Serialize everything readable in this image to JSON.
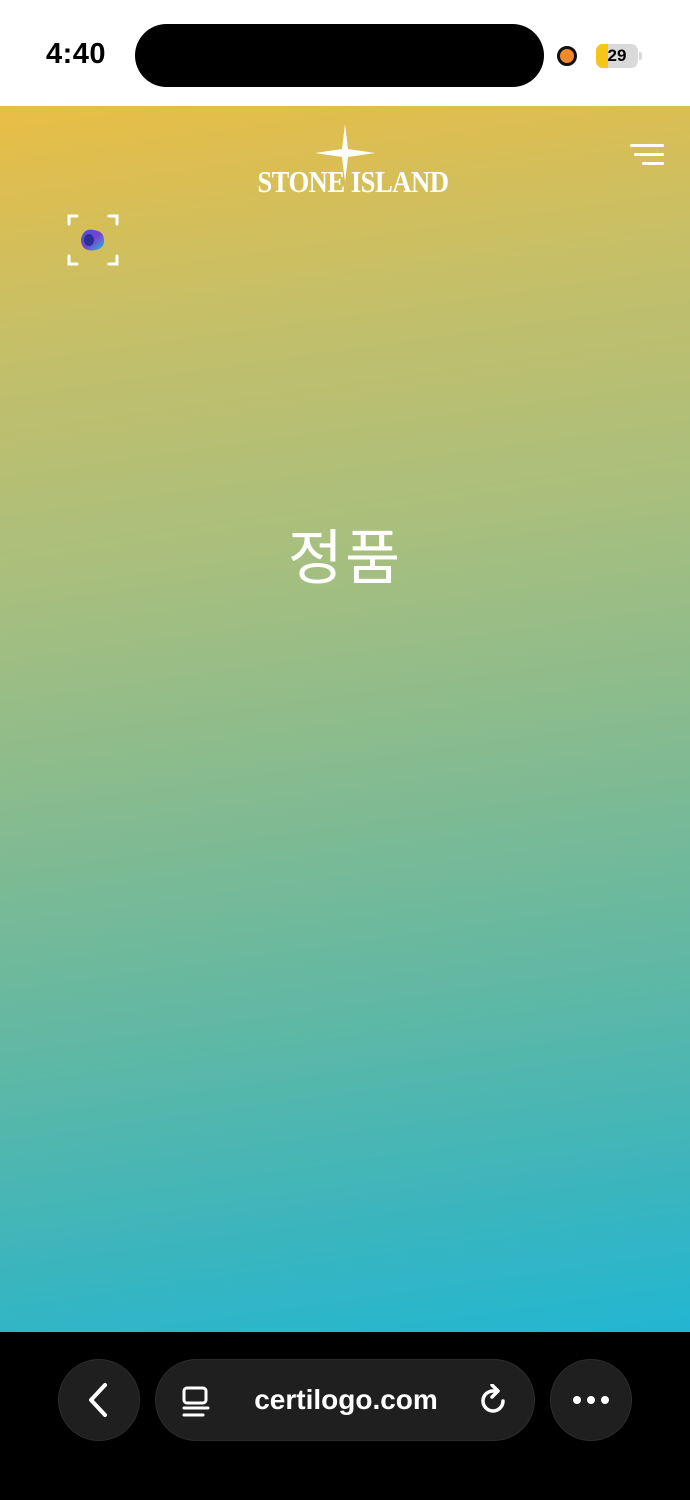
{
  "status_bar": {
    "time": "4:40",
    "battery_level": "29",
    "battery_fraction": 0.29,
    "recording_indicator_color": "#f08a2a",
    "battery_color": "#f5c51a"
  },
  "header": {
    "brand_name": "STONE ISLAND",
    "logo_icon": "compass-star-icon",
    "menu_icon": "menu-icon"
  },
  "main": {
    "scan_icon": "ar-scan-icon",
    "headline": "정품",
    "gradient_colors": [
      "#e9be45",
      "#a9bf7d",
      "#60b8a4",
      "#22b6d2"
    ]
  },
  "browser": {
    "url": "certilogo.com",
    "back_icon": "chevron-left-icon",
    "tabs_icon": "tabs-icon",
    "reload_icon": "reload-icon",
    "more_icon": "more-icon"
  }
}
